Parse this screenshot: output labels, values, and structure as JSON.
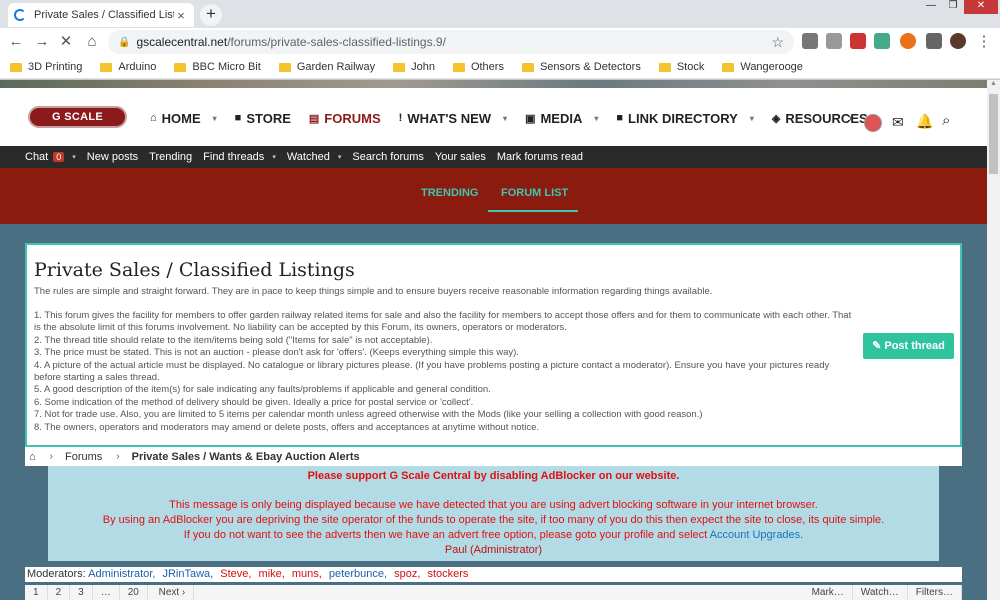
{
  "browser": {
    "tab_title": "Private Sales / Classified Listings",
    "tab_close": "×",
    "new_tab": "+",
    "url_host": "gscalecentral.net",
    "url_path": "/forums/private-sales-classified-listings.9/",
    "window_controls": {
      "min": "—",
      "max": "❐",
      "close": "✕"
    },
    "nav": {
      "back": "←",
      "forward": "→",
      "reload": "✕",
      "home": "⌂"
    },
    "star": "☆",
    "bookmarks": [
      "3D Printing",
      "Arduino",
      "BBC Micro Bit",
      "Garden Railway",
      "John",
      "Others",
      "Sensors & Detectors",
      "Stock",
      "Wangerooge"
    ]
  },
  "site": {
    "logo": "G SCALE CENTRAL",
    "nav": [
      {
        "icon": "⌂",
        "label": "HOME",
        "caret": "▾"
      },
      {
        "icon": "■",
        "label": "STORE",
        "caret": ""
      },
      {
        "icon": "▤",
        "label": "FORUMS",
        "caret": ""
      },
      {
        "icon": "!",
        "label": "WHAT'S NEW",
        "caret": "▾"
      },
      {
        "icon": "▣",
        "label": "MEDIA",
        "caret": "▾"
      },
      {
        "icon": "■",
        "label": "LINK DIRECTORY",
        "caret": "▾"
      },
      {
        "icon": "◈",
        "label": "RESOURCES",
        "caret": ""
      }
    ],
    "nav_more": "›",
    "icons": {
      "mail": "✉",
      "bell": "🔔",
      "search": "⌕"
    },
    "subnav": [
      {
        "label": "Chat",
        "badge": "0",
        "caret": "▾"
      },
      {
        "label": "New posts",
        "caret": ""
      },
      {
        "label": "Trending",
        "caret": ""
      },
      {
        "label": "Find threads",
        "caret": "▾"
      },
      {
        "label": "Watched",
        "caret": "▾"
      },
      {
        "label": "Search forums",
        "caret": ""
      },
      {
        "label": "Your sales",
        "caret": ""
      },
      {
        "label": "Mark forums read",
        "caret": ""
      }
    ],
    "tabs": {
      "trending": "TRENDING",
      "forum_list": "FORUM LIST"
    }
  },
  "forum": {
    "title": "Private Sales / Classified Listings",
    "intro": "The rules are simple and straight forward. They are in pace to keep things simple and to ensure buyers receive reasonable information regarding things available.",
    "rules": [
      "1. This forum gives the facility for members to offer garden railway related items for sale and also the facility for members to accept those offers and for them to communicate with each other. That is the absolute limit of this forums involvement. No liability can be accepted by this Forum, its owners, operators or moderators.",
      "2. The thread title should relate to the item/items being sold (\"Items for sale\" is not acceptable).",
      "3. The price must be stated. This is not an auction - please don't ask for 'offers'. (Keeps everything simple this way).",
      "4. A picture of the actual article must be displayed. No catalogue or library pictures please. (If you have problems posting a picture contact a moderator). Ensure you have your pictures ready before starting a sales thread.",
      "5. A good description of the item(s) for sale indicating any faults/problems if applicable and general condition.",
      "6. Some indication of the method of delivery should be given. Ideally a price for postal service or 'collect'.",
      "7. Not for trade use. Also, you are limited to 5 items per calendar month unless agreed otherwise with the Mods (like your selling a collection with good reason.)",
      "8. The owners, operators and moderators may amend or delete posts, offers and acceptances at anytime without notice."
    ],
    "post_thread": "✎ Post thread"
  },
  "breadcrumb": {
    "home_icon": "⌂",
    "sep": "›",
    "forums": "Forums",
    "current": "Private Sales / Wants & Ebay Auction Alerts"
  },
  "adblock": {
    "heading": "Please support G Scale Central by disabling AdBlocker on our website.",
    "line1": "This message is only being displayed because we have detected that you are using advert blocking software in your internet browser.",
    "line2": "By using an AdBlocker you are depriving the site operator of the funds to operate the site, if too many of you do this then expect the site to close, its quite simple.",
    "line3_pre": "If you do not want to see the adverts then we have an advert free option, please goto your profile and select ",
    "line3_link": "Account Upgrades",
    "line3_post": ".",
    "signature": "Paul (Administrator)"
  },
  "moderators": {
    "label": "Moderators:",
    "names": [
      {
        "name": "Administrator,",
        "color": "#1a5fb4"
      },
      {
        "name": "JRinTawa,",
        "color": "#1a5fb4"
      },
      {
        "name": "Steve,",
        "color": "#d01010"
      },
      {
        "name": "mike,",
        "color": "#d01010"
      },
      {
        "name": "muns,",
        "color": "#d01010"
      },
      {
        "name": "peterbunce,",
        "color": "#1a5fb4"
      },
      {
        "name": "spoz,",
        "color": "#d01010"
      },
      {
        "name": "stockers",
        "color": "#d01010"
      }
    ]
  },
  "pager": {
    "pages": [
      "1",
      "2",
      "3",
      "…",
      "20"
    ],
    "next": "Next ›",
    "actions": [
      "Mark…",
      "Watch…",
      "Filters…"
    ]
  }
}
